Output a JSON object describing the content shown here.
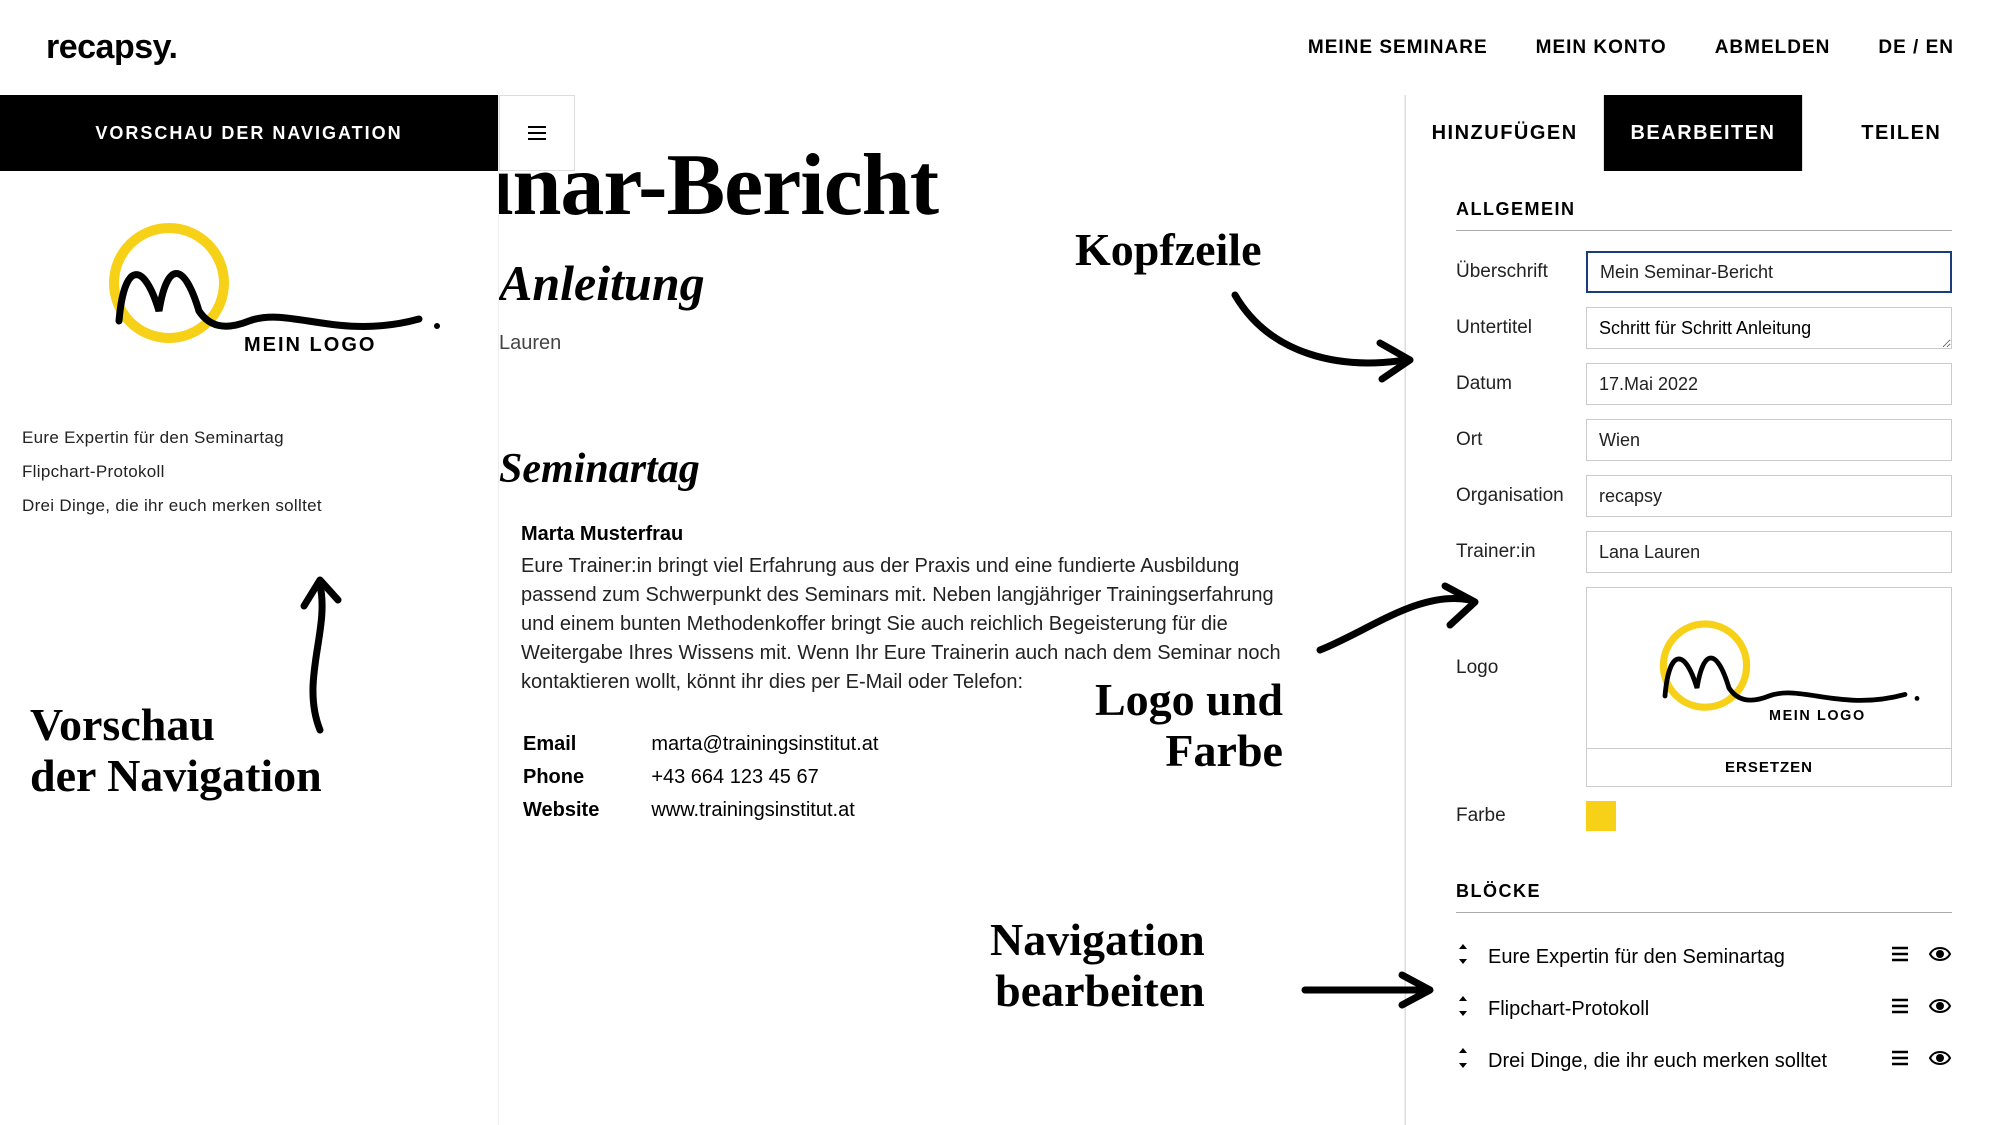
{
  "header": {
    "logo": "recapsy.",
    "nav": {
      "seminars": "MEINE SEMINARE",
      "account": "MEIN KONTO",
      "logout": "ABMELDEN"
    },
    "lang": "DE / EN"
  },
  "left": {
    "title": "VORSCHAU DER NAVIGATION",
    "logo_caption": "MEIN LOGO",
    "items": [
      "Eure Expertin für den Seminartag",
      "Flipchart-Protokoll",
      "Drei Dinge, die ihr euch merken solltet"
    ]
  },
  "doc": {
    "h1": "inar-Bericht",
    "h2": "Anleitung",
    "by": "Lauren",
    "h3": "Seminartag",
    "person": "Marta Musterfrau",
    "body": "Eure Trainer:in bringt viel Erfahrung aus der Praxis und eine fundierte Ausbildung passend zum Schwerpunkt des Seminars mit. Neben langjähriger Trainingserfahrung und einem bunten Methodenkoffer bringt Sie auch reichlich Begeisterung für die Weitergabe Ihres Wissens mit. Wenn Ihr Eure Trainerin auch nach dem Seminar noch kontaktieren wollt, könnt ihr dies per E-Mail oder Telefon:",
    "contacts": {
      "email_label": "Email",
      "email": "marta@trainingsinstitut.at",
      "phone_label": "Phone",
      "phone": "+43 664 123 45 67",
      "web_label": "Website",
      "web": "www.trainingsinstitut.at"
    }
  },
  "tabs": {
    "add": "HINZUFÜGEN",
    "edit": "BEARBEITEN",
    "share": "TEILEN"
  },
  "panel": {
    "section_general": "ALLGEMEIN",
    "labels": {
      "headline": "Überschrift",
      "subtitle": "Untertitel",
      "date": "Datum",
      "place": "Ort",
      "org": "Organisation",
      "trainer": "Trainer:in",
      "logo": "Logo",
      "color": "Farbe"
    },
    "values": {
      "headline": "Mein Seminar-Bericht",
      "subtitle": "Schritt für Schritt Anleitung",
      "date": "17.Mai 2022",
      "place": "Wien",
      "org": "recapsy",
      "trainer": "Lana Lauren"
    },
    "replace": "ERSETZEN",
    "color": "#f7d117",
    "section_blocks": "BLÖCKE",
    "blocks": [
      "Eure Expertin für den Seminartag",
      "Flipchart-Protokoll",
      "Drei Dinge, die ihr euch merken solltet"
    ]
  },
  "annotations": {
    "nav_preview": "Vorschau\nder Navigation",
    "header_note": "Kopfzeile",
    "logo_note": "Logo und\nFarbe",
    "nav_note": "Navigation\nbearbeiten"
  }
}
